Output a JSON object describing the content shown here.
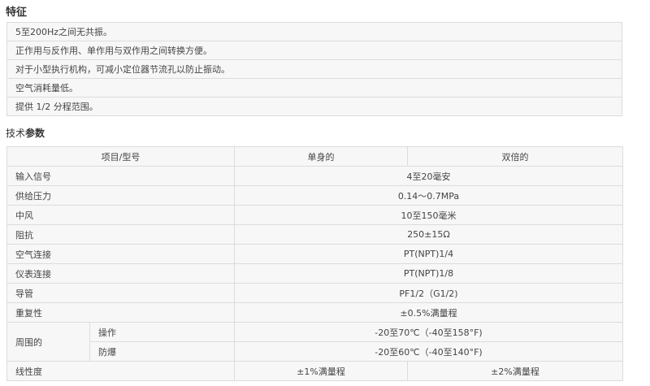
{
  "features": {
    "title": "特征",
    "items": [
      "5至200Hz之间无共振。",
      "正作用与反作用、单作用与双作用之间转换方便。",
      "对于小型执行机构，可减小定位器节流孔以防止振动。",
      "空气消耗量低。",
      "提供 1/2 分程范围。"
    ]
  },
  "params": {
    "title_prefix": "技术",
    "title_bold": "参数",
    "header": {
      "item": "项目/型号",
      "single": "单身的",
      "double": "双倍的"
    },
    "rows": [
      {
        "label": "输入信号",
        "value": "4至20毫安"
      },
      {
        "label": "供给压力",
        "value": "0.14～0.7MPa"
      },
      {
        "label": "中风",
        "value": "10至150毫米"
      },
      {
        "label": "阻抗",
        "value": "250±15Ω"
      },
      {
        "label": "空气连接",
        "value": "PT(NPT)1/4"
      },
      {
        "label": "仪表连接",
        "value": "PT(NPT)1/8"
      },
      {
        "label": "导管",
        "value": "PF1/2（G1/2)"
      },
      {
        "label": "重复性",
        "value": "±0.5%满量程"
      }
    ],
    "ambient": {
      "label": "周围的",
      "operate_label": "操作",
      "operate_value": "-20至70℃（-40至158°F)",
      "explosion_label": "防爆",
      "explosion_value": "-20至60℃（-40至140°F)"
    },
    "linearity": {
      "label": "线性度",
      "single": "±1%满量程",
      "double": "±2%满量程"
    }
  }
}
